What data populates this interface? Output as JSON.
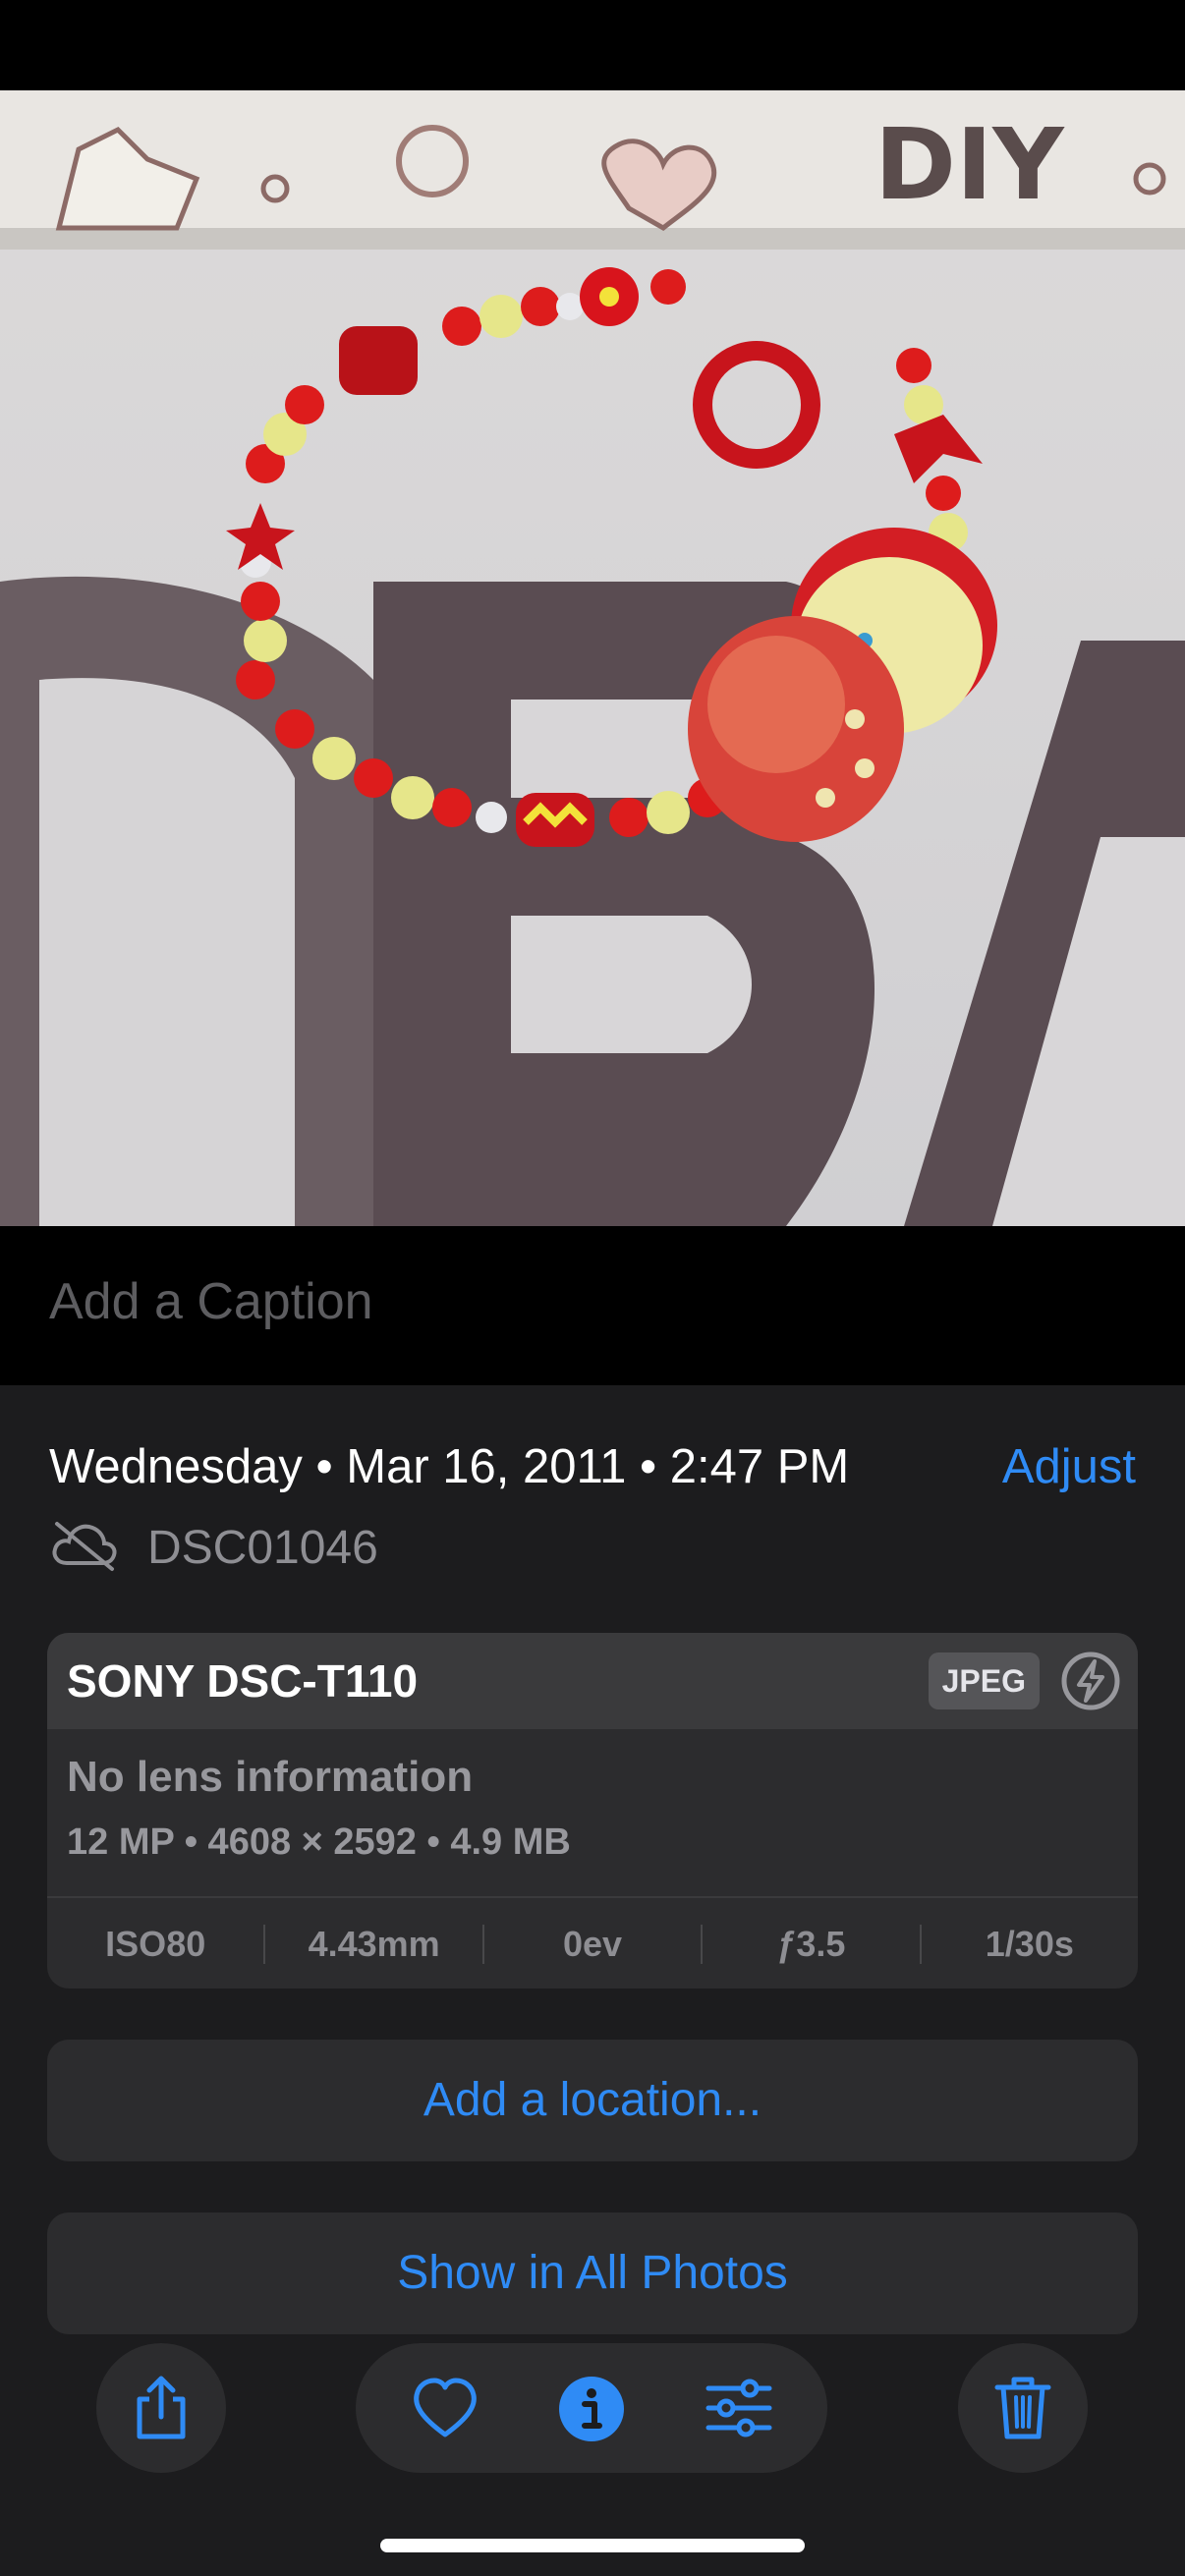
{
  "caption": {
    "placeholder": "Add a Caption"
  },
  "info": {
    "date": "Wednesday • Mar 16, 2011 • 2:47 PM",
    "adjust_label": "Adjust",
    "filename": "DSC01046"
  },
  "camera_card": {
    "camera": "SONY DSC-T110",
    "format_badge": "JPEG",
    "lens": "No lens information",
    "specs": "12 MP • 4608 × 2592 • 4.9 MB",
    "exif": [
      "ISO80",
      "4.43mm",
      "0ev",
      "ƒ3.5",
      "1/30s"
    ]
  },
  "actions": {
    "add_location": "Add a location...",
    "show_in_all_photos": "Show in All Photos"
  },
  "toolbar": {
    "icons": [
      "share-icon",
      "heart-icon",
      "info-icon",
      "adjust-sliders-icon",
      "trash-icon"
    ]
  },
  "colors": {
    "accent": "#2f8bf5",
    "panel": "#1c1c1e",
    "card": "#2c2c2e"
  }
}
